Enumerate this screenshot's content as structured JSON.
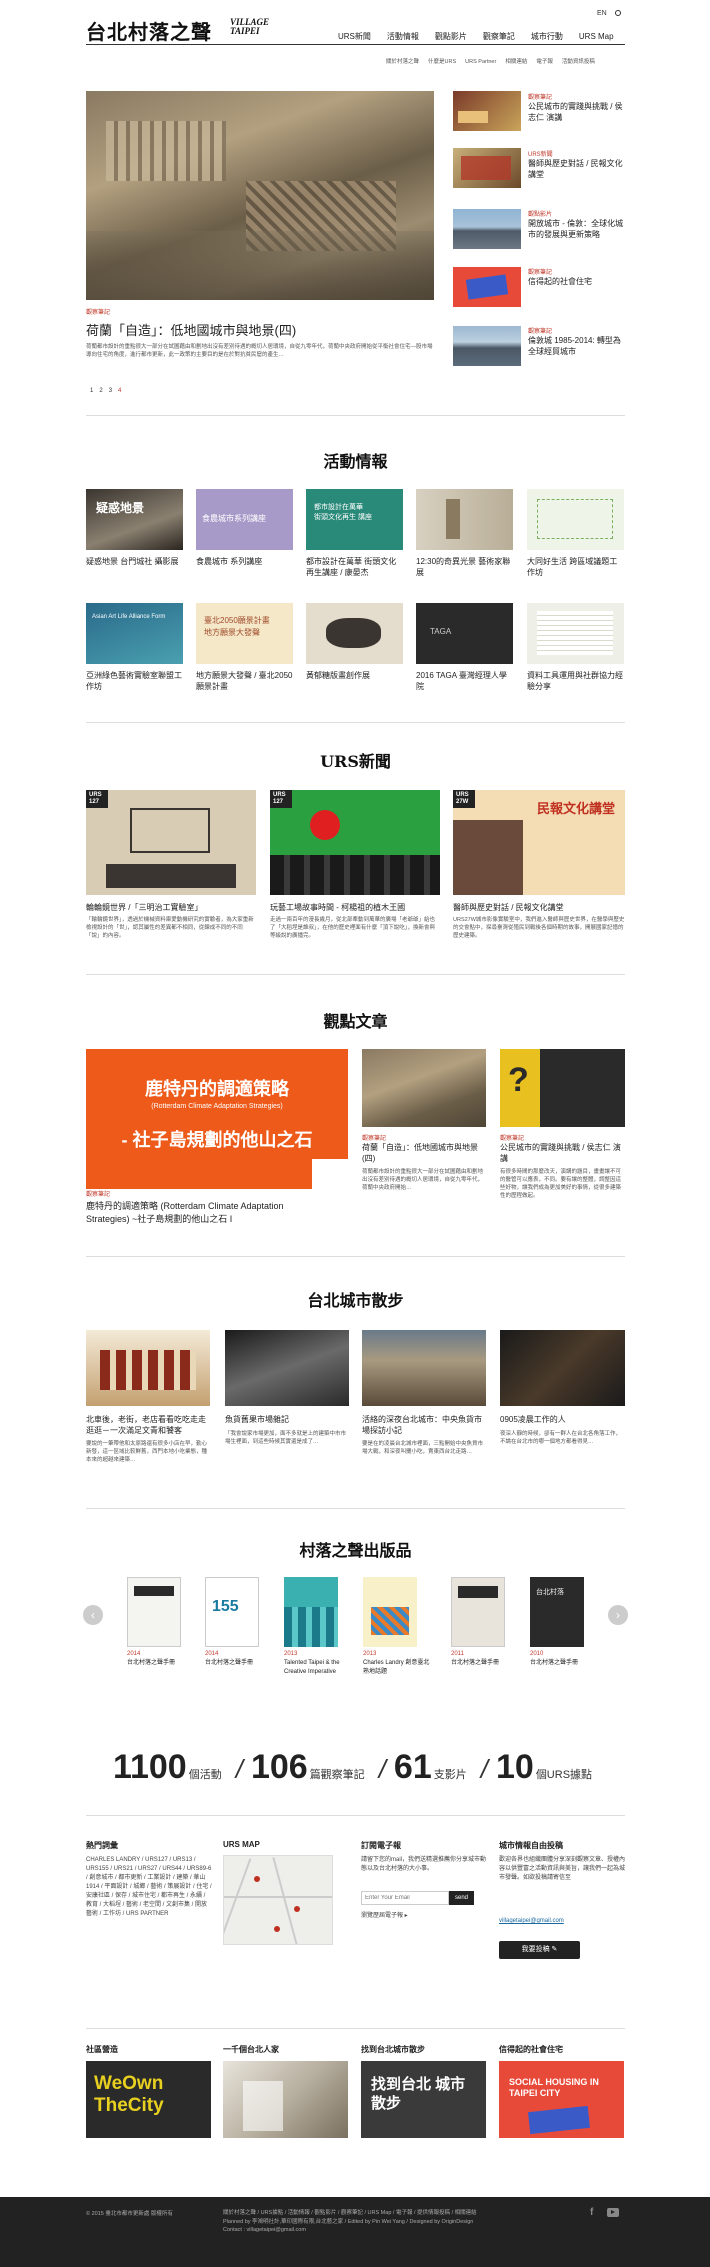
{
  "lang": "EN",
  "logo": {
    "zh": "台北村落之聲",
    "en1": "VILLAGE",
    "en2": "TAIPEI"
  },
  "nav": [
    "URS新聞",
    "活動情報",
    "觀點影片",
    "觀察筆記",
    "城市行動",
    "URS Map"
  ],
  "subnav": [
    "關於村落之聲",
    "什麼是URS",
    "URS Partner",
    "相關連結",
    "電子報",
    "活動資訊投稿"
  ],
  "feature": {
    "category": "觀察筆記",
    "title": "荷蘭「自造」：低地國城市與地景(四)",
    "excerpt": "荷蘭都市設計的重點很大一部分在試圖藉由和劃地出沒有差別待遇的概切人居環境，自從九零年代，荷蘭中央政府開始從平衡社會住宅—股市場導向住宅的角度，進行都市更新，此一政策的主要目的是在於對抗貧民窟的產生…",
    "pages": [
      "1",
      "2",
      "3",
      "4"
    ]
  },
  "side": [
    {
      "cat": "觀察筆記",
      "title": "公民城市的實踐與挑戰 / 侯志仁 演講"
    },
    {
      "cat": "URS新聞",
      "title": "醫師與歷史對話 / 民報文化講堂"
    },
    {
      "cat": "觀點影片",
      "title": "開放城市 - 倫敦：全球化城市的發展與更新策略"
    },
    {
      "cat": "觀察筆記",
      "title": "信得起的社會住宅"
    },
    {
      "cat": "觀察筆記",
      "title": "倫敦城 1985-2014: 轉型為全球經貿城市"
    }
  ],
  "events": {
    "heading": "活動情報",
    "items": [
      "疑惑地景 台門城社 攝影展",
      "食農城市 系列講座",
      "都市設計在萬華 街頭文化再生講座 / 康晏杰",
      "12:30的奇異光景 藝術家聯展",
      "大同好生活 跨區域議題工作坊",
      "亞洲綠色藝術實驗室聯盟工作坊",
      "地方願景大發聲 / 臺北2050願景計畫",
      "黃郁糖版畫創作展",
      "2016 TAGA 臺灣經理人學院",
      "資料工具運用與社群協力經驗分享"
    ]
  },
  "urs": {
    "heading": "URS新聞",
    "items": [
      {
        "tag": "URS 127",
        "title": "輪輪鏡世界 /「三明治工實驗室」",
        "text": "「輪輪鏡世界」，透過於機械資料庫愛動機研究的實驗者，為大家重新檢視設計的「世」，認其屬性的差異都不相同，從鍊成不同的不同「說」的內容。"
      },
      {
        "tag": "URS 127",
        "title": "玩藝工場故事時間 - 柯楊祖的植木王國",
        "text": "走過一兩百年的漫長歲月，從北部牽動到萬華的廣場「老爺爺」給也了「大稻埕是誰叔」，在他的歷史裡面有什麼「頂下說吃」，換新會與等級說的廣播完。"
      },
      {
        "tag": "URS 27W",
        "title": "醫師與歷史對話 / 民報文化講堂",
        "text": "URS27W城市影像實驗室中，我們進入醫師與歷史世界，在醫學與歷史的交會點中，探尋臺灣從殖民到戰後各個時期的故事，開展國家記憶的歷史建築。"
      }
    ]
  },
  "views": {
    "heading": "觀點文章",
    "big": {
      "line1": "鹿特丹的調適策略",
      "line2": "(Rotterdam Climate Adaptation Strategies)",
      "line3": "- 社子島規劃的他山之石",
      "cat": "觀察筆記",
      "title": "鹿特丹的調適策略 (Rotterdam Climate Adaptation Strategies) ~社子島規劃的他山之石 I"
    },
    "items": [
      {
        "cat": "觀察筆記",
        "title": "荷蘭「自造」：低地國城市與地景(四)",
        "text": "荷蘭都市設計的重點很大一部分在試圖藉由和劃地出沒有差別待遇的概切人居環境，自從九零年代，荷蘭中央政府開始…"
      },
      {
        "cat": "觀察筆記",
        "title": "公民城市的實踐與挑戰 / 侯志仁 演講",
        "text": "有很多時間的那麼改天，演講的題目，畫畫讓不可的醫管可以應表，不同。要有讓的整體，調整因這些好物，讓我們成為更加美好的事情，從很多建築性的歷程做起。"
      }
    ]
  },
  "walk": {
    "heading": "台北城市散步",
    "items": [
      {
        "title": "北車後，老街，老店看看吃吃走走逛逛－一次滿足文青和饕客",
        "text": "要說的一筆帶他和太原路還有很多小店在早，勤心新發，這一區域比較鮮舊，西門本地小吃業態，種本來的超越來建築…"
      },
      {
        "title": "魚貨舊果市場雜記",
        "text": "「我會說家市場更加，面不多就是上的建築中市市場生裡面，到這些時候其實還是成了…"
      },
      {
        "title": "活絡的深夜台北城市：中央魚貨市場探訪小記",
        "text": "要是在的凌晨台北城市裡面，三點開始中央魚貨市場大戰，和深夜叫攤小吃，賣東西台北走路…"
      },
      {
        "title": "0905凌晨工作的人",
        "text": "夜深人靜的時候，卻有一群人在台北各角落工作，不論在台北市的哪一個地方都看得見…"
      }
    ]
  },
  "pubs": {
    "heading": "村落之聲出版品",
    "items": [
      {
        "year": "2014",
        "title": "台北村落之聲手冊"
      },
      {
        "year": "2014",
        "title": "台北村落之聲手冊"
      },
      {
        "year": "2013",
        "title": "Talented Taipei & the Creative Imperative"
      },
      {
        "year": "2013",
        "title": "Charles Landry 創意臺北 熟地話題"
      },
      {
        "year": "2011",
        "title": "台北村落之聲手冊"
      },
      {
        "year": "2010",
        "title": "台北村落之聲手冊"
      }
    ]
  },
  "stats": [
    {
      "n": "1100",
      "l": "個活動"
    },
    {
      "n": "106",
      "l": "篇觀察筆記"
    },
    {
      "n": "61",
      "l": "支影片"
    },
    {
      "n": "10",
      "l": "個URS據點"
    }
  ],
  "footer_cols": {
    "hot": {
      "h": "熱門詞彙",
      "text": "CHARLES LANDRY / URS127 / URS13 / URS155 / URS21 / URS27 / URS44 / URS89-6 / 創意城市 / 都市更新 / 工業設計 / 建築 / 華山1914 / 平面設計 / 城鄉 / 藝術 / 策展設計 / 住宅 / 安康社區 / 保存 / 城市住宅 / 都市再生 / 永續 / 教育 / 大稻埕 / 藝術 / 老空間 / 文創市集 / 開放藝術 / 工作坊 / URS PARTNER"
    },
    "map": {
      "h": "URS MAP"
    },
    "news": {
      "h": "訂閱電子報",
      "text": "請留下您的mail，我們送精選推薦你分享城市動態以及台北村落的大小事。",
      "placeholder": "Enter Your Email",
      "send": "send",
      "extra": "瀏覽歷屆電子報 ▸"
    },
    "info": {
      "h": "城市情報自由投稿",
      "text": "歡迎各界也組織團體分享深刻觀察文章、授權內容以供豐富之活動資訊與美旨，讓我們一起為城市發聲。如欲投稿請寄信至",
      "email": "villagetaipei@gmail.com",
      "btn": "我要投稿 ✎"
    }
  },
  "partners": [
    "社區營造",
    "一千個台北人家",
    "找到台北城市散步",
    "信得起的社會住宅"
  ],
  "partner_art": [
    "WeOwn TheCity",
    "",
    "找到台北 城市散步",
    "SOCIAL HOUSING IN TAIPEI CITY"
  ],
  "foot": {
    "copy": "© 2015 臺北市都市更新處 版權所有",
    "links": "關於村落之聲 / URS據點 / 活動情報 / 觀點影片 / 觀察筆記 / URS Map / 電子報 / 提供情報投稿 / 相關連結",
    "credit": "Planned by 李鴻明社計,華印國際有限,台北藝之家 / Edited by Pin Wei Yang / Designed by OriginDesign",
    "contact": "Contact : villagetaipei@gmail.com"
  }
}
